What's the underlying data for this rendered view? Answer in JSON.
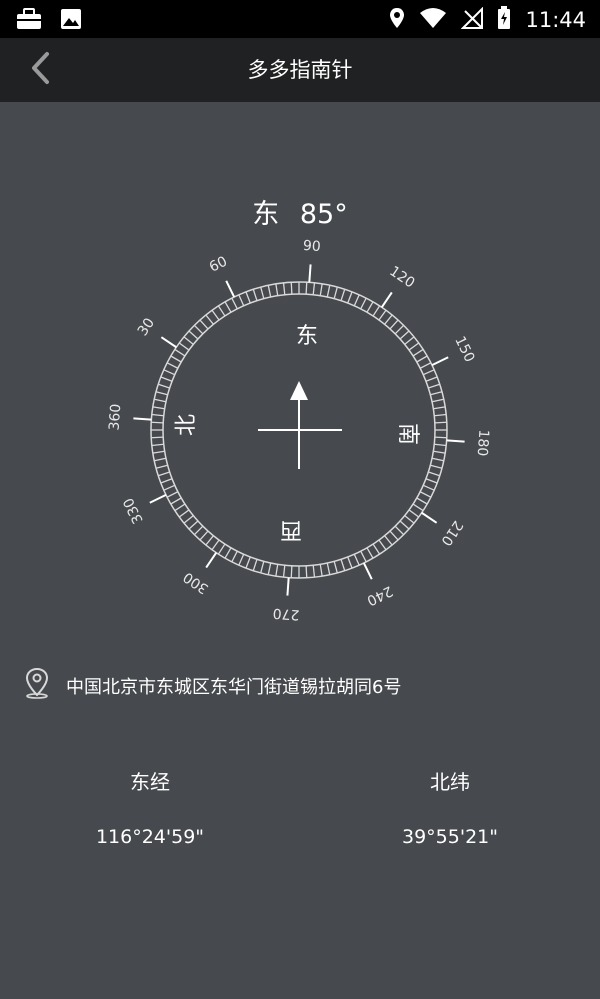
{
  "status_bar": {
    "time": "11:44",
    "icons": [
      "briefcase-icon",
      "image-icon",
      "location-icon",
      "wifi-icon",
      "no-signal-icon",
      "battery-charging-icon"
    ]
  },
  "app_bar": {
    "title": "多多指南针",
    "back_icon": "chevron-left-icon"
  },
  "heading": {
    "direction": "东",
    "degrees": "85°"
  },
  "compass": {
    "ring_labels": [
      "90",
      "120",
      "150",
      "180",
      "210",
      "240",
      "270",
      "300",
      "330",
      "360",
      "30",
      "60"
    ],
    "cardinals": {
      "east": "东",
      "south": "南",
      "west": "西",
      "north": "北"
    }
  },
  "address": {
    "icon": "map-pin-icon",
    "text": "中国北京市东城区东华门街道锡拉胡同6号"
  },
  "coordinates": {
    "longitude_label": "东经",
    "longitude_value": "116°24'59\"",
    "latitude_label": "北纬",
    "latitude_value": "39°55'21\""
  }
}
